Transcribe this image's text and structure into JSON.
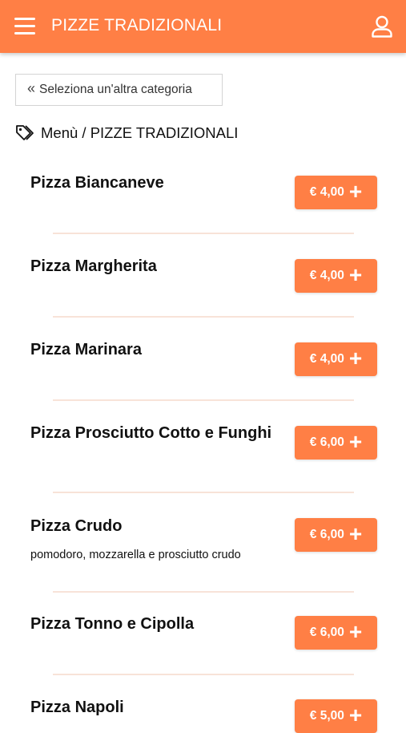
{
  "header": {
    "title": "PIZZE TRADIZIONALI",
    "menu_icon": "hamburger-menu-icon",
    "user_icon": "user-icon",
    "color": "#ff7f45"
  },
  "back_button": {
    "label": "Seleziona un'altra categoria",
    "icon": "double-chevron-left-icon"
  },
  "breadcrumb": {
    "label": "Menù / PIZZE TRADIZIONALI",
    "icon": "tags-icon"
  },
  "items": [
    {
      "name": "Pizza Biancaneve",
      "price": "€ 4,00",
      "description": ""
    },
    {
      "name": "Pizza Margherita",
      "price": "€ 4,00",
      "description": ""
    },
    {
      "name": "Pizza Marinara",
      "price": "€ 4,00",
      "description": ""
    },
    {
      "name": "Pizza Prosciutto Cotto e Funghi",
      "price": "€ 6,00",
      "description": ""
    },
    {
      "name": "Pizza Crudo",
      "price": "€ 6,00",
      "description": "pomodoro, mozzarella e prosciutto crudo"
    },
    {
      "name": "Pizza Tonno e Cipolla",
      "price": "€ 6,00",
      "description": ""
    },
    {
      "name": "Pizza Napoli",
      "price": "€ 5,00",
      "description": ""
    }
  ],
  "add_icon": "plus-icon"
}
